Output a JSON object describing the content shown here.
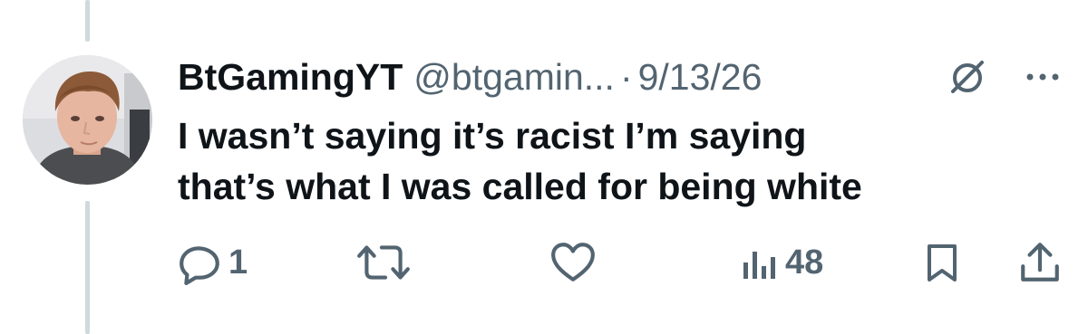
{
  "tweet": {
    "display_name": "BtGamingYT",
    "handle": "@btgamin...",
    "separator": "·",
    "date": "9/13/26",
    "text": "I wasn’t saying it’s racist I’m saying\nthat’s what I was called for being white"
  },
  "actions": {
    "reply_count": "1",
    "views_count": "48"
  },
  "icons": {
    "header": [
      "grok-icon",
      "more-icon"
    ],
    "action_bar": [
      "reply-icon",
      "retweet-icon",
      "like-icon",
      "views-icon",
      "bookmark-icon",
      "share-icon"
    ]
  },
  "colors": {
    "text": "#0f1419",
    "secondary": "#536471",
    "thread_line": "#cfd9de",
    "background": "#ffffff"
  }
}
